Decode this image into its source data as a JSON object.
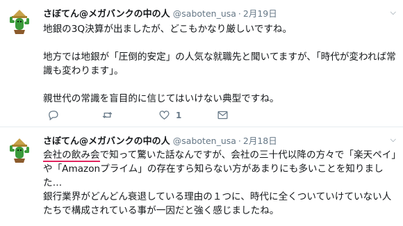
{
  "tweets": [
    {
      "name": "さぼてん@メガバンクの中の人",
      "handle": "@saboten_usa",
      "dot": "·",
      "date": "2月19日",
      "body": "地銀の3Q決算が出ましたが、どこもかなり厳しいですね。\n\n地方では地銀が「圧倒的安定」の人気な就職先と聞いてますが、「時代が変われば常識も変わります」。\n\n親世代の常識を盲目的に信じてはいけない典型ですね。",
      "actions": {
        "reply_count": "",
        "retweet_count": "",
        "like_count": "1"
      }
    },
    {
      "name": "さぼてん@メガバンクの中の人",
      "handle": "@saboten_usa",
      "dot": "·",
      "date": "2月18日",
      "body_underlined": "会社の飲み会",
      "body_rest": "で知って驚いた話なんですが、会社の三十代以降の方々で「楽天ペイ」や「Amazonプライム」の存在すら知らない方があまりにも多いことを知りました…\n銀行業界がどんどん衰退している理由の１つに、時代に全くついていけていない人たちで構成されている事が一因だと強く感じましたね。"
    }
  ],
  "icons": {
    "avatar": "cactus-avatar-icon",
    "menu": "chevron-down-icon",
    "reply": "reply-icon",
    "retweet": "retweet-icon",
    "like": "heart-icon",
    "dm": "envelope-icon"
  },
  "colors": {
    "text": "#14171a",
    "muted": "#657786",
    "underline": "#e0245e",
    "avatar_green": "#3a9a3a",
    "avatar_hat": "#c7a24a"
  }
}
